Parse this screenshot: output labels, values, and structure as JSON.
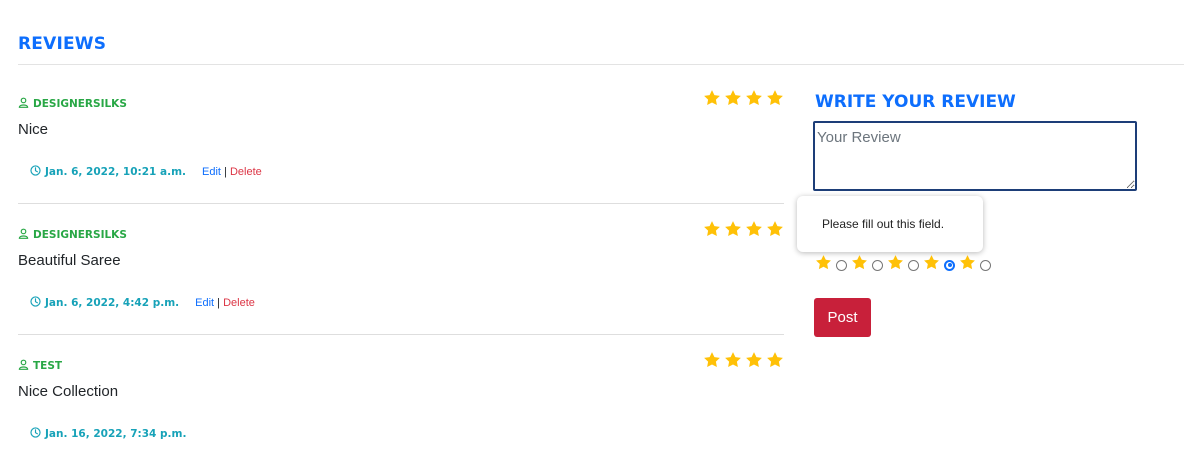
{
  "section_title": "REVIEWS",
  "reviews": [
    {
      "author": "DESIGNERSILKS",
      "text": "Nice",
      "date": "Jan. 6, 2022, 10:21 a.m.",
      "stars": 4,
      "edit_label": "Edit",
      "separator": "|",
      "delete_label": "Delete"
    },
    {
      "author": "DESIGNERSILKS",
      "text": "Beautiful Saree",
      "date": "Jan. 6, 2022, 4:42 p.m.",
      "stars": 4,
      "edit_label": "Edit",
      "separator": "|",
      "delete_label": "Delete"
    },
    {
      "author": "TEST",
      "text": "Nice Collection",
      "date": "Jan. 16, 2022, 7:34 p.m.",
      "stars": 4
    }
  ],
  "write_review": {
    "title": "WRITE YOUR REVIEW",
    "placeholder": "Your Review",
    "value": "",
    "tooltip": "Please fill out this field.",
    "rating_options": 5,
    "selected_rating": 4,
    "post_label": "Post"
  },
  "colors": {
    "accent": "#0d6efd",
    "author": "#28a745",
    "date": "#17a2b8",
    "delete": "#dc3545",
    "star": "#ffc107",
    "post_button": "#c8203a"
  },
  "icons": {
    "author": "user-icon",
    "date": "clock-icon",
    "rating": "star-icon"
  }
}
